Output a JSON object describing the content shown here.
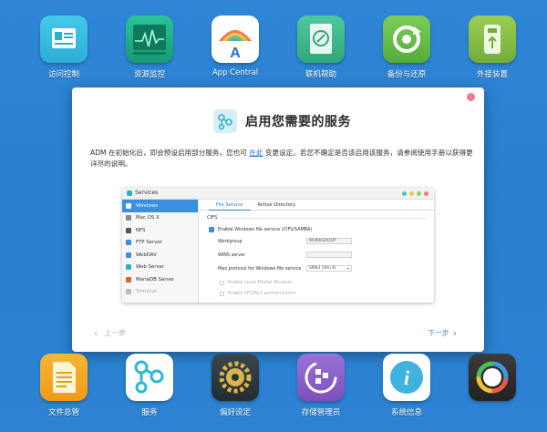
{
  "top_apps": [
    {
      "label": "访问控制",
      "icon": "access-control-icon",
      "color": "#36bde0"
    },
    {
      "label": "资源监控",
      "icon": "resource-monitor-icon",
      "color": "#1fb58a"
    },
    {
      "label": "App Central",
      "icon": "app-central-icon",
      "color": "#ffffff"
    },
    {
      "label": "联机帮助",
      "icon": "online-help-icon",
      "color": "#45c093"
    },
    {
      "label": "备份与还原",
      "icon": "backup-restore-icon",
      "color": "#69c04a"
    },
    {
      "label": "外接装置",
      "icon": "external-device-icon",
      "color": "#8cc24a"
    }
  ],
  "dock_apps": [
    {
      "label": "文件总管",
      "icon": "file-explorer-icon",
      "color": "#f5a623"
    },
    {
      "label": "服务",
      "icon": "services-icon",
      "color": "#2db9d0"
    },
    {
      "label": "偏好设定",
      "icon": "preferences-icon",
      "color": "#2f3a40"
    },
    {
      "label": "存储管理员",
      "icon": "storage-manager-icon",
      "color": "#8b62c9"
    },
    {
      "label": "系统信息",
      "icon": "system-info-icon",
      "color": "#3fb2df"
    },
    {
      "label": "",
      "icon": "activity-monitor-icon",
      "color": "#333333"
    }
  ],
  "dialog": {
    "title": "启用您需要的服务",
    "desc_before_link": "ADM 在初始化后，即会预设启用部分服务，您也可 ",
    "desc_link": "在此",
    "desc_after_link": " 变更设定。若您不确定是否该启用该服务，请参阅使用手册以获得更详尽的说明。",
    "prev_label": "上一步",
    "next_label": "下一步",
    "accent": "#2a7fd0"
  },
  "services_window": {
    "title": "Services",
    "sidebar": [
      {
        "label": "Windows",
        "active": true,
        "color": "#3a8fe0"
      },
      {
        "label": "Mac OS X",
        "active": false,
        "color": "#8a8a8a"
      },
      {
        "label": "NFS",
        "active": false,
        "color": "#555555"
      },
      {
        "label": "FTP Server",
        "active": false,
        "color": "#3a8fe0"
      },
      {
        "label": "WebDAV",
        "active": false,
        "color": "#3a8fe0"
      },
      {
        "label": "Web Server",
        "active": false,
        "color": "#2ab3c8"
      },
      {
        "label": "MariaDB Server",
        "active": false,
        "color": "#c96a2e"
      },
      {
        "label": "Terminal",
        "active": false,
        "color": "#666666"
      }
    ],
    "tabs": [
      "File Service",
      "Active Directory"
    ],
    "section": "CIFS",
    "enable_label": "Enable Windows file service (CIFS/SAMBA)",
    "workgroup_label": "Workgroup",
    "workgroup_value": "WORKGROUP",
    "wins_label": "WINS server",
    "wins_value": "",
    "protocol_label": "Max protocol for Windows file service",
    "protocol_value": "SMB3 (Win 8)",
    "local_master_label": "Enable Local Master Browser",
    "ntlm_label": "Enable NTLMv1 authentication"
  }
}
